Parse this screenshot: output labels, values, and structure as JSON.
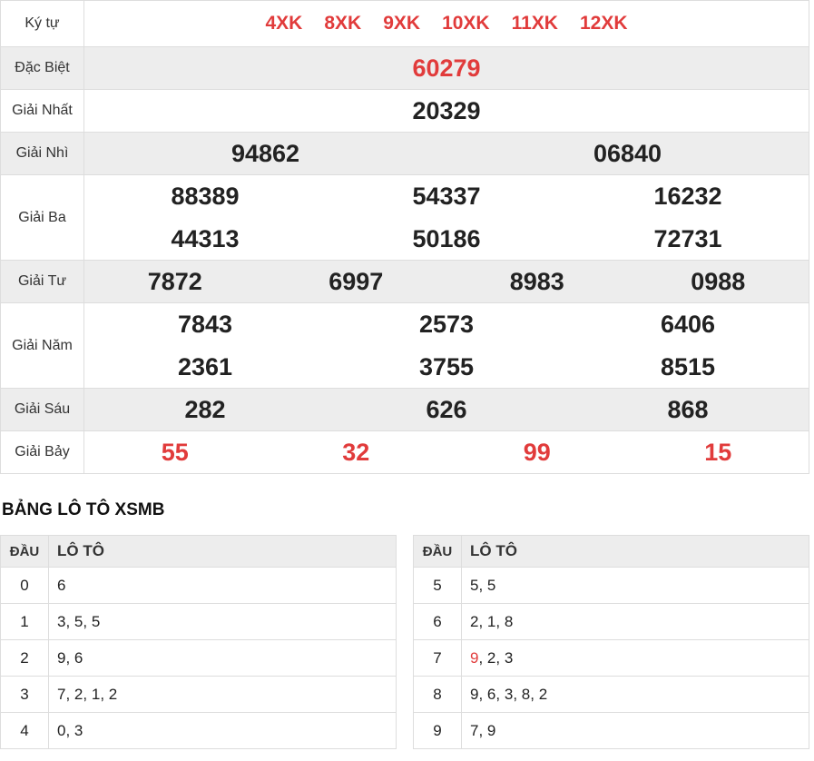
{
  "colors": {
    "red": "#e13b3b",
    "shaded_bg": "#ededed",
    "border": "#dddddd",
    "number_text": "#222222",
    "label_text": "#333333"
  },
  "results_table": {
    "rows": [
      {
        "label": "Ký tự",
        "kind": "codes",
        "shaded": false,
        "red": true,
        "lines": [
          [
            "4XK",
            "8XK",
            "9XK",
            "10XK",
            "11XK",
            "12XK"
          ]
        ]
      },
      {
        "label": "Đặc Biệt",
        "kind": "numbers",
        "shaded": true,
        "red": true,
        "lines": [
          [
            "60279"
          ]
        ]
      },
      {
        "label": "Giải Nhất",
        "kind": "numbers",
        "shaded": false,
        "red": false,
        "lines": [
          [
            "20329"
          ]
        ]
      },
      {
        "label": "Giải Nhì",
        "kind": "numbers",
        "shaded": true,
        "red": false,
        "lines": [
          [
            "94862",
            "06840"
          ]
        ]
      },
      {
        "label": "Giải Ba",
        "kind": "numbers",
        "shaded": false,
        "red": false,
        "lines": [
          [
            "88389",
            "54337",
            "16232"
          ],
          [
            "44313",
            "50186",
            "72731"
          ]
        ]
      },
      {
        "label": "Giải Tư",
        "kind": "numbers",
        "shaded": true,
        "red": false,
        "lines": [
          [
            "7872",
            "6997",
            "8983",
            "0988"
          ]
        ]
      },
      {
        "label": "Giải Năm",
        "kind": "numbers",
        "shaded": false,
        "red": false,
        "lines": [
          [
            "7843",
            "2573",
            "6406"
          ],
          [
            "2361",
            "3755",
            "8515"
          ]
        ]
      },
      {
        "label": "Giải Sáu",
        "kind": "numbers",
        "shaded": true,
        "red": false,
        "lines": [
          [
            "282",
            "626",
            "868"
          ]
        ]
      },
      {
        "label": "Giải Bảy",
        "kind": "numbers",
        "shaded": false,
        "red": true,
        "lines": [
          [
            "55",
            "32",
            "99",
            "15"
          ]
        ]
      }
    ]
  },
  "loto_section": {
    "heading": "BẢNG LÔ TÔ XSMB",
    "columns": {
      "dau": "ĐẦU",
      "loto": "LÔ TÔ"
    },
    "tables": [
      {
        "side": "left",
        "rows": [
          {
            "dau": "0",
            "values": [
              "6"
            ],
            "red_indices": []
          },
          {
            "dau": "1",
            "values": [
              "3",
              "5",
              "5"
            ],
            "red_indices": []
          },
          {
            "dau": "2",
            "values": [
              "9",
              "6"
            ],
            "red_indices": []
          },
          {
            "dau": "3",
            "values": [
              "7",
              "2",
              "1",
              "2"
            ],
            "red_indices": []
          },
          {
            "dau": "4",
            "values": [
              "0",
              "3"
            ],
            "red_indices": []
          }
        ]
      },
      {
        "side": "right",
        "rows": [
          {
            "dau": "5",
            "values": [
              "5",
              "5"
            ],
            "red_indices": []
          },
          {
            "dau": "6",
            "values": [
              "2",
              "1",
              "8"
            ],
            "red_indices": []
          },
          {
            "dau": "7",
            "values": [
              "9",
              "2",
              "3"
            ],
            "red_indices": [
              0
            ]
          },
          {
            "dau": "8",
            "values": [
              "9",
              "6",
              "3",
              "8",
              "2"
            ],
            "red_indices": []
          },
          {
            "dau": "9",
            "values": [
              "7",
              "9"
            ],
            "red_indices": []
          }
        ]
      }
    ]
  }
}
